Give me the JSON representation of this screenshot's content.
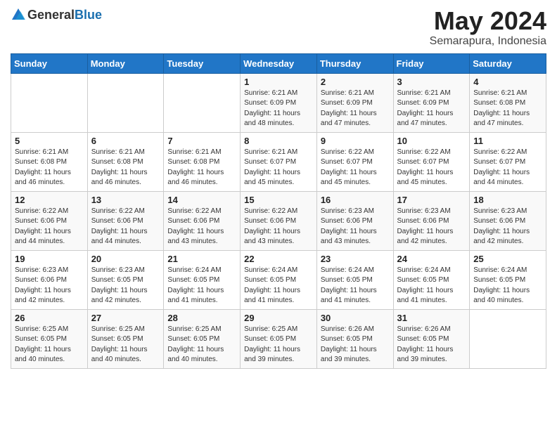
{
  "logo": {
    "general": "General",
    "blue": "Blue"
  },
  "header": {
    "title": "May 2024",
    "subtitle": "Semarapura, Indonesia"
  },
  "weekdays": [
    "Sunday",
    "Monday",
    "Tuesday",
    "Wednesday",
    "Thursday",
    "Friday",
    "Saturday"
  ],
  "weeks": [
    [
      {
        "day": "",
        "content": ""
      },
      {
        "day": "",
        "content": ""
      },
      {
        "day": "",
        "content": ""
      },
      {
        "day": "1",
        "content": "Sunrise: 6:21 AM\nSunset: 6:09 PM\nDaylight: 11 hours and 48 minutes."
      },
      {
        "day": "2",
        "content": "Sunrise: 6:21 AM\nSunset: 6:09 PM\nDaylight: 11 hours and 47 minutes."
      },
      {
        "day": "3",
        "content": "Sunrise: 6:21 AM\nSunset: 6:09 PM\nDaylight: 11 hours and 47 minutes."
      },
      {
        "day": "4",
        "content": "Sunrise: 6:21 AM\nSunset: 6:08 PM\nDaylight: 11 hours and 47 minutes."
      }
    ],
    [
      {
        "day": "5",
        "content": "Sunrise: 6:21 AM\nSunset: 6:08 PM\nDaylight: 11 hours and 46 minutes."
      },
      {
        "day": "6",
        "content": "Sunrise: 6:21 AM\nSunset: 6:08 PM\nDaylight: 11 hours and 46 minutes."
      },
      {
        "day": "7",
        "content": "Sunrise: 6:21 AM\nSunset: 6:08 PM\nDaylight: 11 hours and 46 minutes."
      },
      {
        "day": "8",
        "content": "Sunrise: 6:21 AM\nSunset: 6:07 PM\nDaylight: 11 hours and 45 minutes."
      },
      {
        "day": "9",
        "content": "Sunrise: 6:22 AM\nSunset: 6:07 PM\nDaylight: 11 hours and 45 minutes."
      },
      {
        "day": "10",
        "content": "Sunrise: 6:22 AM\nSunset: 6:07 PM\nDaylight: 11 hours and 45 minutes."
      },
      {
        "day": "11",
        "content": "Sunrise: 6:22 AM\nSunset: 6:07 PM\nDaylight: 11 hours and 44 minutes."
      }
    ],
    [
      {
        "day": "12",
        "content": "Sunrise: 6:22 AM\nSunset: 6:06 PM\nDaylight: 11 hours and 44 minutes."
      },
      {
        "day": "13",
        "content": "Sunrise: 6:22 AM\nSunset: 6:06 PM\nDaylight: 11 hours and 44 minutes."
      },
      {
        "day": "14",
        "content": "Sunrise: 6:22 AM\nSunset: 6:06 PM\nDaylight: 11 hours and 43 minutes."
      },
      {
        "day": "15",
        "content": "Sunrise: 6:22 AM\nSunset: 6:06 PM\nDaylight: 11 hours and 43 minutes."
      },
      {
        "day": "16",
        "content": "Sunrise: 6:23 AM\nSunset: 6:06 PM\nDaylight: 11 hours and 43 minutes."
      },
      {
        "day": "17",
        "content": "Sunrise: 6:23 AM\nSunset: 6:06 PM\nDaylight: 11 hours and 42 minutes."
      },
      {
        "day": "18",
        "content": "Sunrise: 6:23 AM\nSunset: 6:06 PM\nDaylight: 11 hours and 42 minutes."
      }
    ],
    [
      {
        "day": "19",
        "content": "Sunrise: 6:23 AM\nSunset: 6:06 PM\nDaylight: 11 hours and 42 minutes."
      },
      {
        "day": "20",
        "content": "Sunrise: 6:23 AM\nSunset: 6:05 PM\nDaylight: 11 hours and 42 minutes."
      },
      {
        "day": "21",
        "content": "Sunrise: 6:24 AM\nSunset: 6:05 PM\nDaylight: 11 hours and 41 minutes."
      },
      {
        "day": "22",
        "content": "Sunrise: 6:24 AM\nSunset: 6:05 PM\nDaylight: 11 hours and 41 minutes."
      },
      {
        "day": "23",
        "content": "Sunrise: 6:24 AM\nSunset: 6:05 PM\nDaylight: 11 hours and 41 minutes."
      },
      {
        "day": "24",
        "content": "Sunrise: 6:24 AM\nSunset: 6:05 PM\nDaylight: 11 hours and 41 minutes."
      },
      {
        "day": "25",
        "content": "Sunrise: 6:24 AM\nSunset: 6:05 PM\nDaylight: 11 hours and 40 minutes."
      }
    ],
    [
      {
        "day": "26",
        "content": "Sunrise: 6:25 AM\nSunset: 6:05 PM\nDaylight: 11 hours and 40 minutes."
      },
      {
        "day": "27",
        "content": "Sunrise: 6:25 AM\nSunset: 6:05 PM\nDaylight: 11 hours and 40 minutes."
      },
      {
        "day": "28",
        "content": "Sunrise: 6:25 AM\nSunset: 6:05 PM\nDaylight: 11 hours and 40 minutes."
      },
      {
        "day": "29",
        "content": "Sunrise: 6:25 AM\nSunset: 6:05 PM\nDaylight: 11 hours and 39 minutes."
      },
      {
        "day": "30",
        "content": "Sunrise: 6:26 AM\nSunset: 6:05 PM\nDaylight: 11 hours and 39 minutes."
      },
      {
        "day": "31",
        "content": "Sunrise: 6:26 AM\nSunset: 6:05 PM\nDaylight: 11 hours and 39 minutes."
      },
      {
        "day": "",
        "content": ""
      }
    ]
  ]
}
